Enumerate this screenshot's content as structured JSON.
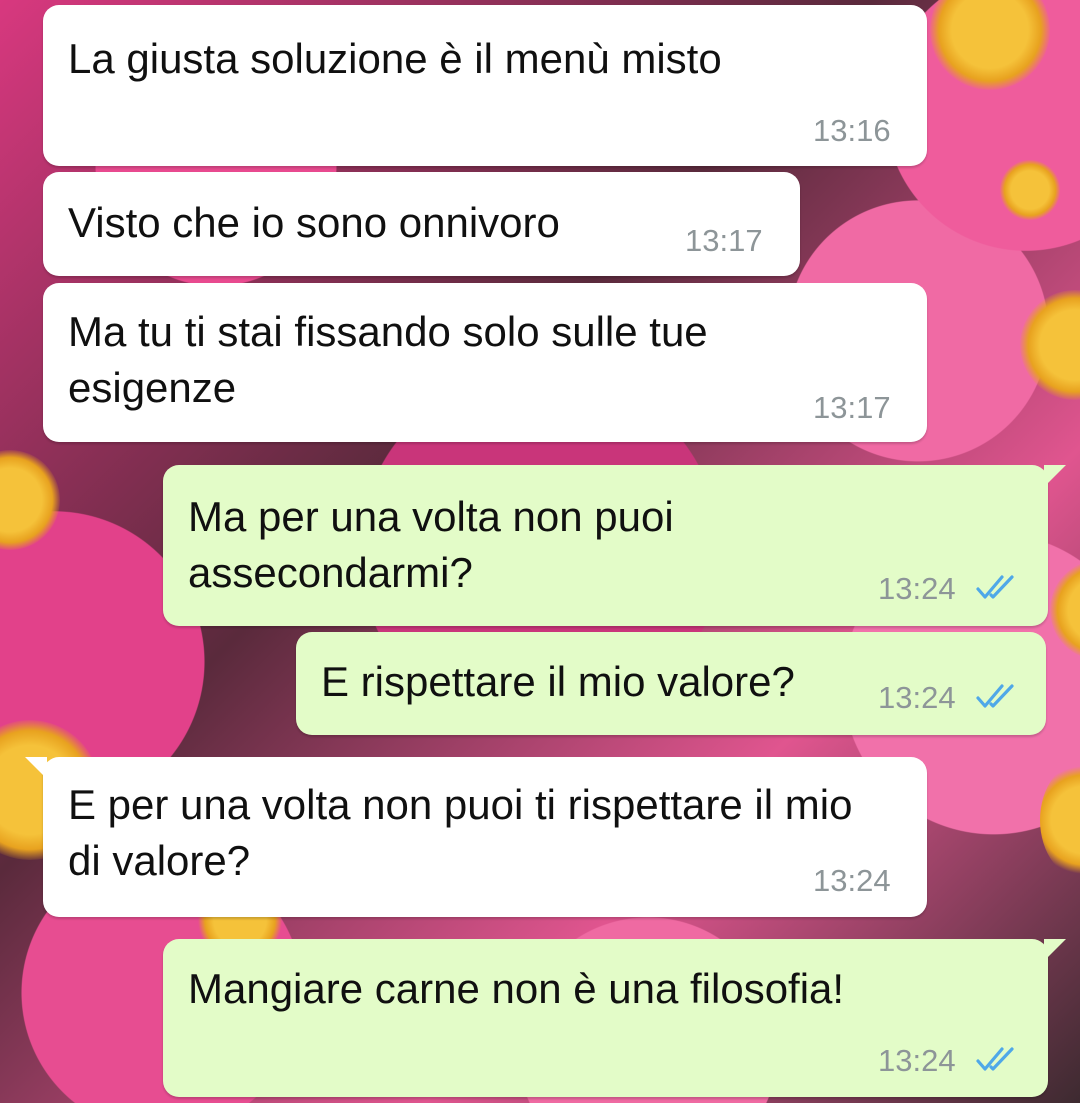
{
  "chat": {
    "messages": [
      {
        "direction": "incoming",
        "text": "La giusta soluzione è il menù misto",
        "time": "13:16"
      },
      {
        "direction": "incoming",
        "text": "Visto che io sono onnivoro",
        "time": "13:17"
      },
      {
        "direction": "incoming",
        "text": "Ma tu ti stai fissando solo sulle tue esigenze",
        "time": "13:17"
      },
      {
        "direction": "outgoing",
        "text": "Ma per una volta non puoi assecondarmi?",
        "time": "13:24",
        "status": "read"
      },
      {
        "direction": "outgoing",
        "text": "E rispettare il mio valore?",
        "time": "13:24",
        "status": "read"
      },
      {
        "direction": "incoming",
        "text": "E per una volta non puoi ti rispettare il mio di valore?",
        "time": "13:24"
      },
      {
        "direction": "outgoing",
        "text": "Mangiare carne non è una filosofia!",
        "time": "13:24",
        "status": "read"
      }
    ]
  },
  "icons": {
    "read_receipt": "double-check-icon"
  },
  "colors": {
    "incoming_bubble": "#ffffff",
    "outgoing_bubble": "#e3fcc8",
    "timestamp": "#8d9598",
    "read_tick": "#4fa8e8",
    "wallpaper_accent": "#e84a8f"
  }
}
